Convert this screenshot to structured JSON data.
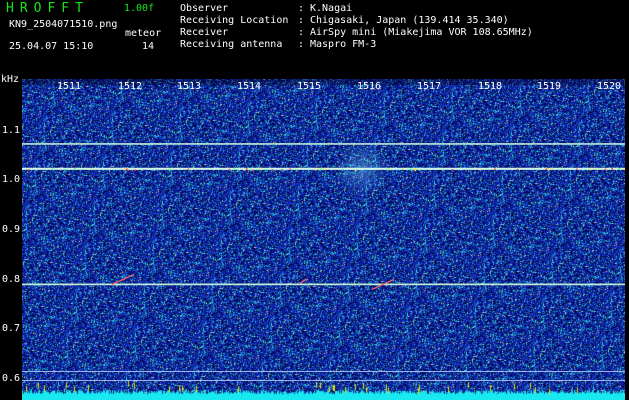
{
  "header": {
    "brand": "HROFFT",
    "version": "1.00f",
    "filename": "KN9_2504071510.png",
    "mode": "meteor",
    "timestamp": "25.04.07 15:10",
    "count": "14",
    "meta": [
      {
        "label": "Observer",
        "sep": ":",
        "value": "K.Nagai"
      },
      {
        "label": "Receiving Location",
        "sep": ":",
        "value": "Chigasaki, Japan (139.414 35.340)"
      },
      {
        "label": "Receiver",
        "sep": ":",
        "value": "AirSpy mini (Miakejima VOR 108.65MHz)"
      },
      {
        "label": "Receiving antenna",
        "sep": ":",
        "value": "Maspro FM-3"
      }
    ]
  },
  "axes": {
    "y_unit": "kHz",
    "y_ticks": [
      "1.1",
      "1.0",
      "0.9",
      "0.8",
      "0.7",
      "0.6"
    ],
    "x_ticks": [
      "1511",
      "1512",
      "1513",
      "1514",
      "1515",
      "1516",
      "1517",
      "1518",
      "1519",
      "1520"
    ]
  },
  "colors": {
    "background": "#000000",
    "brand": "#14e614",
    "noise_floor": "#0a1aa8",
    "carrier": "#c8f5e0",
    "bottom_band": "#18e8f0"
  },
  "carriers_khz": [
    1.072,
    1.022,
    0.79,
    0.615,
    0.597
  ]
}
